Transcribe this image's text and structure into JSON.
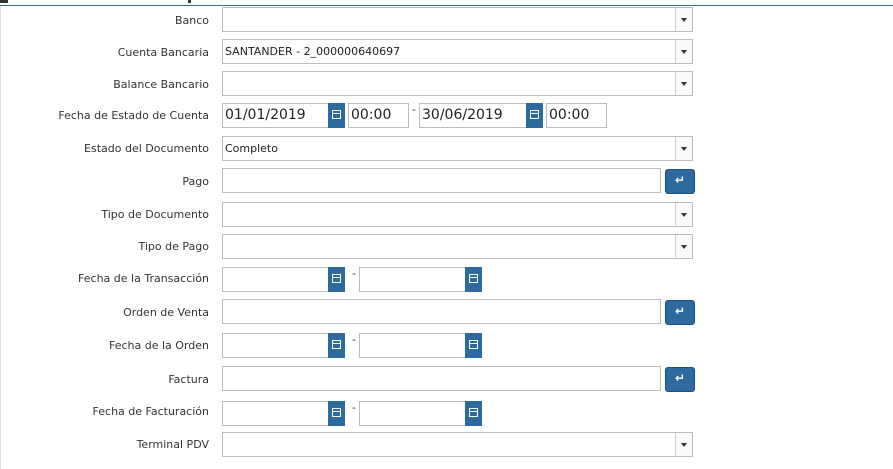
{
  "fields": {
    "banco": {
      "label": "Banco",
      "value": ""
    },
    "cuenta_bancaria": {
      "label": "Cuenta Bancaria",
      "value": "SANTANDER  - 2_000000640697"
    },
    "balance_bancario": {
      "label": "Balance Bancario",
      "value": ""
    },
    "fecha_estado_cuenta": {
      "label": "Fecha de Estado de Cuenta",
      "from_date": "01/01/2019",
      "from_time": "00:00",
      "to_date": "30/06/2019",
      "to_time": "00:00"
    },
    "estado_documento": {
      "label": "Estado del Documento",
      "value": "Completo"
    },
    "pago": {
      "label": "Pago",
      "value": ""
    },
    "tipo_documento": {
      "label": "Tipo de Documento",
      "value": ""
    },
    "tipo_pago": {
      "label": "Tipo de Pago",
      "value": ""
    },
    "fecha_transaccion": {
      "label": "Fecha de la Transacción",
      "from_date": "",
      "to_date": ""
    },
    "orden_venta": {
      "label": "Orden de Venta",
      "value": ""
    },
    "fecha_orden": {
      "label": "Fecha de la Orden",
      "from_date": "",
      "to_date": ""
    },
    "factura": {
      "label": "Factura",
      "value": ""
    },
    "fecha_facturacion": {
      "label": "Fecha de Facturación",
      "from_date": "",
      "to_date": ""
    },
    "terminal_pdv": {
      "label": "Terminal PDV",
      "value": ""
    }
  },
  "range_separator": "-",
  "icons": {
    "dropdown": "chevron-down-icon",
    "calendar": "calendar-icon",
    "search": "search-icon"
  },
  "colors": {
    "button_blue": "#2c6aa0",
    "border": "#bdbdbd"
  }
}
